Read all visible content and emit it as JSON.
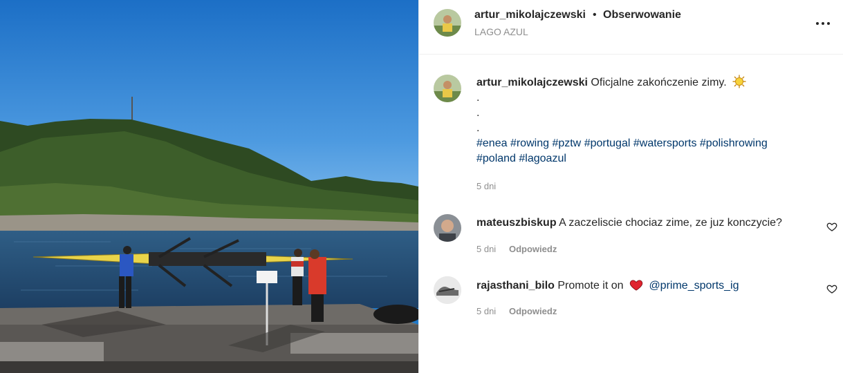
{
  "post": {
    "username": "artur_mikolajczewski",
    "separator": "•",
    "follow_label": "Obserwowanie",
    "location": "LAGO AZUL",
    "more_icon": "more-horizontal-icon"
  },
  "caption": {
    "username": "artur_mikolajczewski",
    "text": "Oficjalne zakończenie zimy.",
    "emoji": "sun-emoji",
    "dot_lines": [
      ".",
      ".",
      "."
    ],
    "hashtags": [
      "#enea",
      "#rowing",
      "#pztw",
      "#portugal",
      "#watersports",
      "#polishrowing",
      "#poland",
      "#lagoazul"
    ],
    "time": "5 dni"
  },
  "comments": [
    {
      "username": "mateuszbiskup",
      "text": "A zaczeliscie chociaz zime, ze juz konczycie?",
      "time": "5 dni",
      "reply_label": "Odpowiedz"
    },
    {
      "username": "rajasthani_bilo",
      "text_before": "Promote it on",
      "emoji": "red-heart-emoji",
      "mention": "@prime_sports_ig",
      "time": "5 dni",
      "reply_label": "Odpowiedz"
    }
  ],
  "colors": {
    "text": "#262626",
    "secondary": "#8e8e8e",
    "link": "#00376b",
    "divider": "#efefef",
    "heart": "#ed4956"
  }
}
